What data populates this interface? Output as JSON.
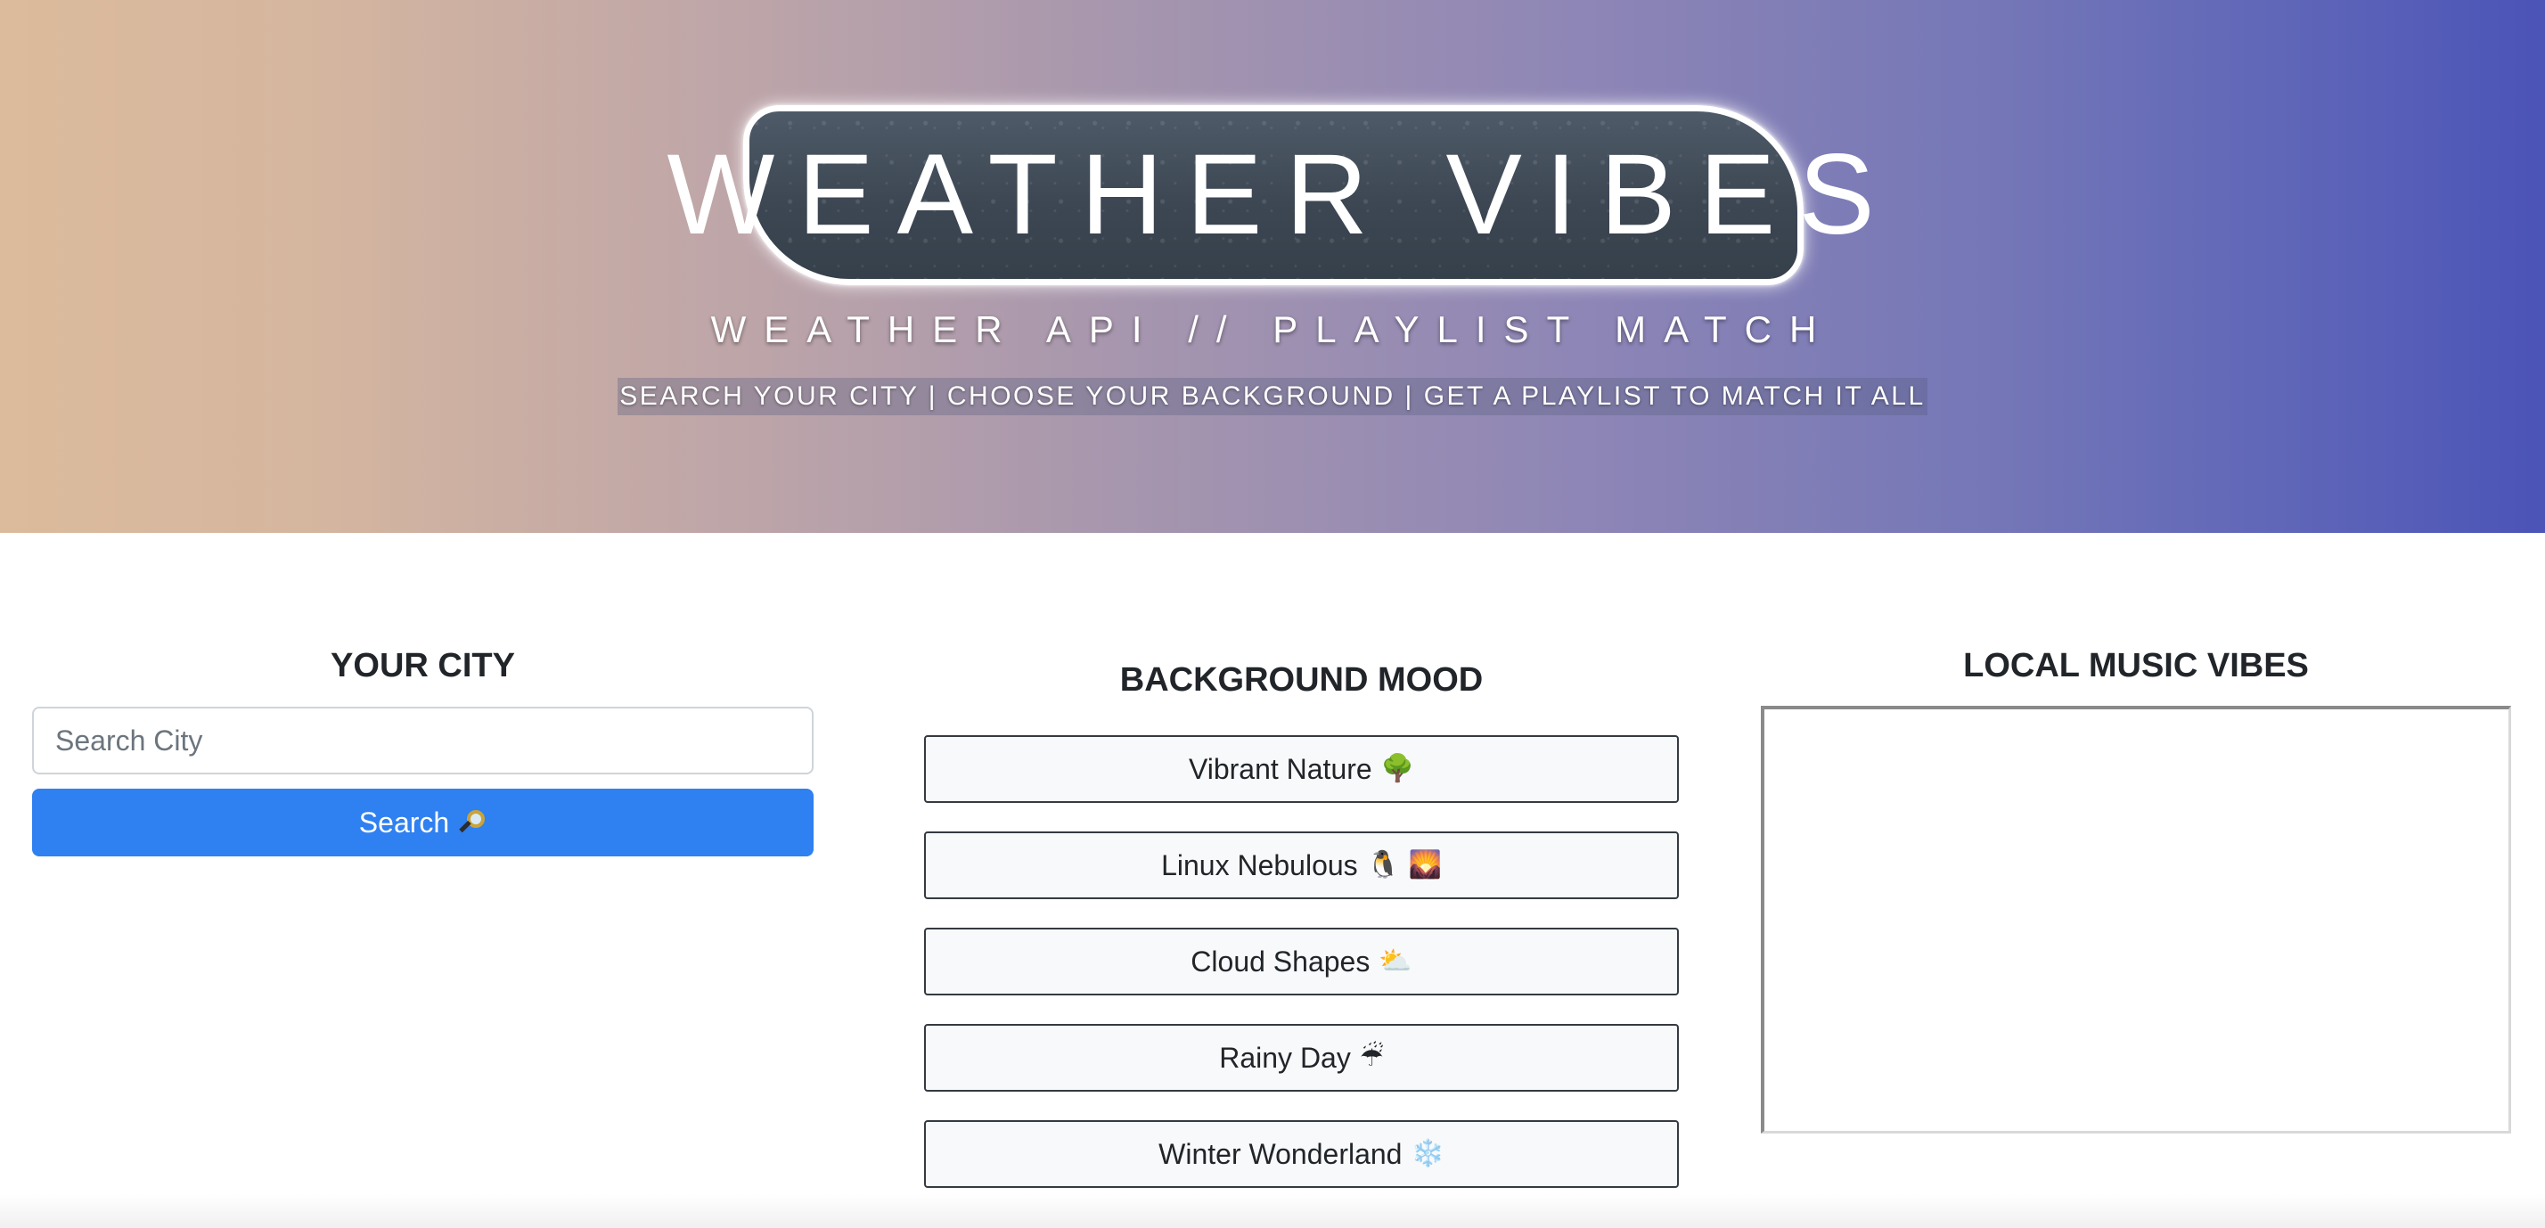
{
  "header": {
    "title": "WEATHER VIBES",
    "subtitle": "WEATHER API // PLAYLIST MATCH",
    "tagline": "SEARCH YOUR CITY | CHOOSE YOUR BACKGROUND | GET A PLAYLIST TO MATCH IT ALL"
  },
  "city": {
    "heading": "YOUR CITY",
    "search_placeholder": "Search City",
    "search_value": "",
    "search_button_label": "Search",
    "search_button_icon": "magnifying-glass-icon"
  },
  "mood": {
    "heading": "BACKGROUND MOOD",
    "buttons": [
      {
        "label": "Vibrant Nature",
        "emoji": "🌳"
      },
      {
        "label": "Linux Nebulous",
        "emoji": "🐧 🌄"
      },
      {
        "label": "Cloud Shapes",
        "emoji": "⛅"
      },
      {
        "label": "Rainy Day",
        "emoji": "☔"
      },
      {
        "label": "Winter Wonderland",
        "emoji": "❄️"
      }
    ]
  },
  "music": {
    "heading": "LOCAL MUSIC VIBES"
  },
  "colors": {
    "hero_gradient_start": "#dcbb9c",
    "hero_gradient_end": "#4b54b7",
    "primary_button": "#2f80f0",
    "title_box": "#3d4753"
  }
}
